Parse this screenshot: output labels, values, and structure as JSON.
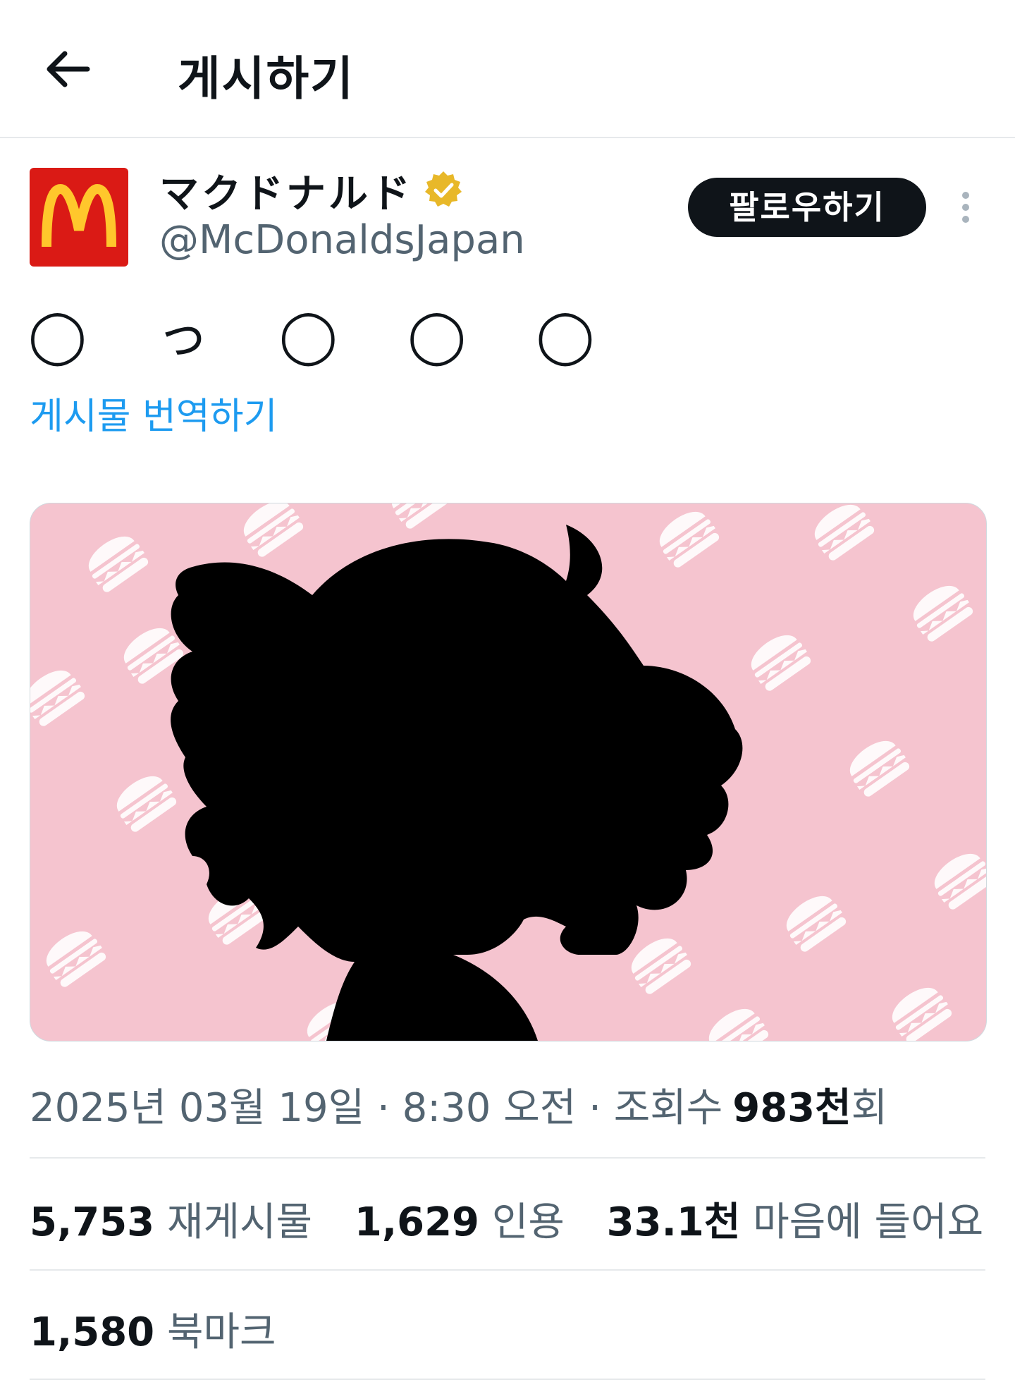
{
  "header": {
    "title": "게시하기",
    "back_icon": "arrow-left-icon"
  },
  "author": {
    "display_name": "マクドナルド",
    "handle": "@McDonaldsJapan",
    "verified_icon": "verified-badge-icon",
    "avatar_logo": "McDonald's golden arches",
    "brand_color": "#da1a15",
    "verified_color": "#e8b829"
  },
  "actions": {
    "follow_label": "팔로우하기",
    "more_icon": "more-vertical-icon"
  },
  "post": {
    "text": "◯ っ ◯ ◯ ◯",
    "translate_label": "게시물 번역하기",
    "media": {
      "description_color_bg": "#f5c4cf",
      "pattern_icon": "burger-icon"
    }
  },
  "meta": {
    "date": "2025년 03월 19일",
    "separator": "·",
    "time": "8:30 오전",
    "views_label": "조회수",
    "views_value": "983천",
    "views_suffix": "회"
  },
  "stats": {
    "reposts_num": "5,753",
    "reposts_label": "재게시물",
    "quotes_num": "1,629",
    "quotes_label": "인용",
    "likes_num": "33.1천",
    "likes_label": "마음에 들어요",
    "bookmarks_num": "1,580",
    "bookmarks_label": "북마크"
  }
}
